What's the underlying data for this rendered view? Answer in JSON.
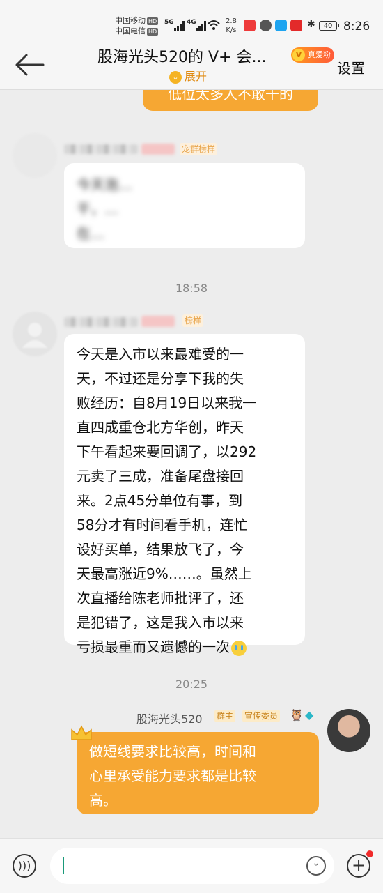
{
  "status_bar": {
    "carrier_1": "中国移动",
    "carrier_2": "中国电信",
    "hd": "HD",
    "sig1": "5G",
    "sig2": "4G",
    "net_speed_value": "2.8",
    "net_speed_unit": "K/s",
    "battery": "40",
    "time": "8:26"
  },
  "header": {
    "title": "股海光头520的 V+ 会...",
    "fan_badge": "真爱粉",
    "fan_badge_icon": "V",
    "settings": "设置",
    "expand": "展开"
  },
  "messages": {
    "top_bubble_text": "低位太多人不敢干的",
    "blurred_bubble_line1": "今天泡…",
    "blurred_bubble_line2": "干，…",
    "blurred_bubble_line3": "在…",
    "tag_model_1": "宠群榜样",
    "tag_model_2": "榜样",
    "timestamp_1": "18:58",
    "long_message": [
      "今天是入市以来最难受的一",
      "天，不过还是分享下我的失",
      "败经历：自8月19日以来我一",
      "直四成重仓北方华创，昨天",
      "下午看起来要回调了，以292",
      "元卖了三成，准备尾盘接回",
      "来。2点45分单位有事，到",
      "58分才有时间看手机，连忙",
      "设好买单，结果放飞了，今",
      "天最高涨近9%……。虽然上",
      "次直播给陈老师批评了，还",
      "是犯错了，这是我入市以来",
      "亏损最重而又遗憾的一次"
    ],
    "timestamp_2": "20:25",
    "sender_name": "股海光头520",
    "tag_owner": "群主",
    "tag_committee": "宣传委员",
    "reply_lines": [
      "做短线要求比较高，时间和",
      "心里承受能力要求都是比较",
      "高。"
    ]
  },
  "colors": {
    "orange_bubble": "#f6a733",
    "background": "#ededed",
    "accent_text": "#e08a10"
  },
  "icons": {
    "back": "back-arrow-icon",
    "voice": "voice-icon",
    "emoji": "emoji-icon",
    "plus": "plus-icon",
    "crown": "crown-icon"
  }
}
